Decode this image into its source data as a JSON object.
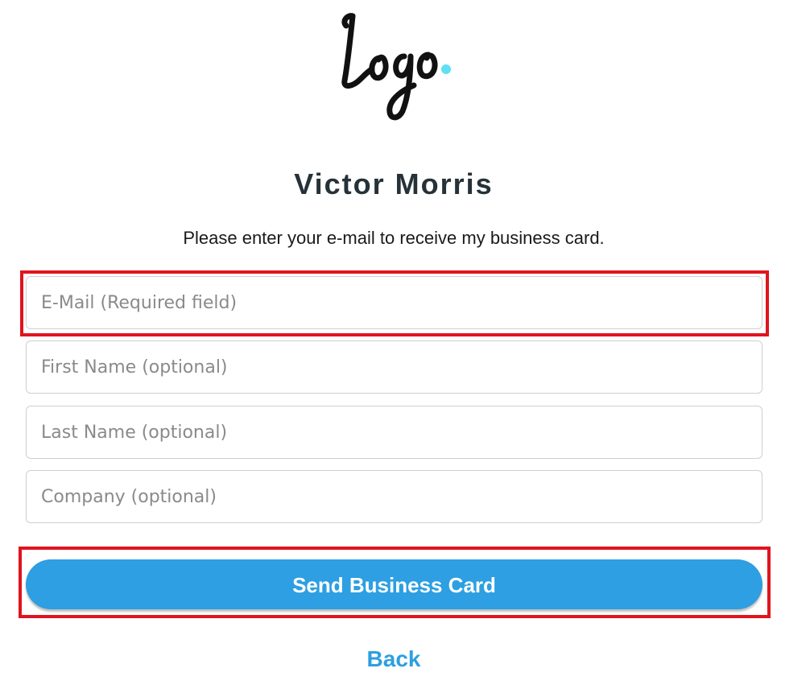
{
  "logo": {
    "text": "Logo",
    "dot_color": "#5de0f5"
  },
  "profile": {
    "name": "Victor Morris",
    "instruction": "Please enter your e-mail to receive my business card."
  },
  "form": {
    "email": {
      "value": "",
      "placeholder": "E-Mail (Required field)"
    },
    "first_name": {
      "value": "",
      "placeholder": "First Name (optional)"
    },
    "last_name": {
      "value": "",
      "placeholder": "Last Name (optional)"
    },
    "company": {
      "value": "",
      "placeholder": "Company (optional)"
    },
    "submit_label": "Send Business Card"
  },
  "nav": {
    "back_label": "Back"
  },
  "colors": {
    "accent": "#2d9fe2",
    "highlight": "#e0141e",
    "title": "#263238"
  }
}
